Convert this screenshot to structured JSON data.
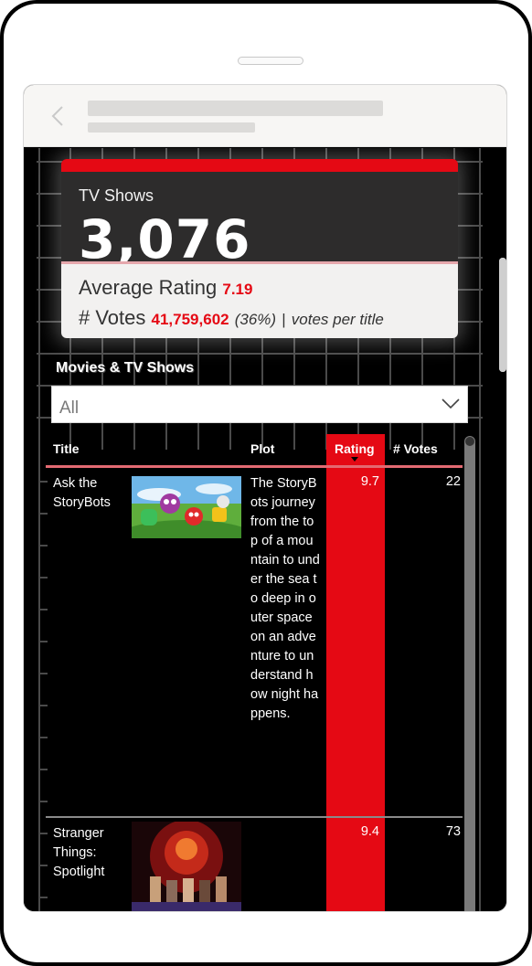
{
  "kpi": {
    "label": "TV Shows",
    "value": "3,076",
    "avg_label": "Average Rating",
    "avg_value": "7.19",
    "votes_label": "# Votes",
    "votes_value": "41,759,602",
    "votes_pct": "(36%)",
    "separator": "|",
    "votes_note": "votes per title"
  },
  "slicer": {
    "title": "Movies & TV Shows",
    "value": "All"
  },
  "table": {
    "headers": {
      "title": "Title",
      "plot": "Plot",
      "rating": "Rating",
      "votes": "# Votes"
    },
    "rows": [
      {
        "title": "Ask the StoryBots",
        "plot": "The StoryBots journey from the top of a mountain to under the sea to deep in outer space on an adventure to understand how night happens.",
        "rating": "9.7",
        "votes": "22"
      },
      {
        "title": "Stranger Things: Spotlight",
        "plot": "",
        "rating": "9.4",
        "votes": "73"
      }
    ]
  },
  "colors": {
    "accent": "#e50914",
    "card_dark": "#2d2c2c",
    "card_light": "#f2f1f0"
  }
}
